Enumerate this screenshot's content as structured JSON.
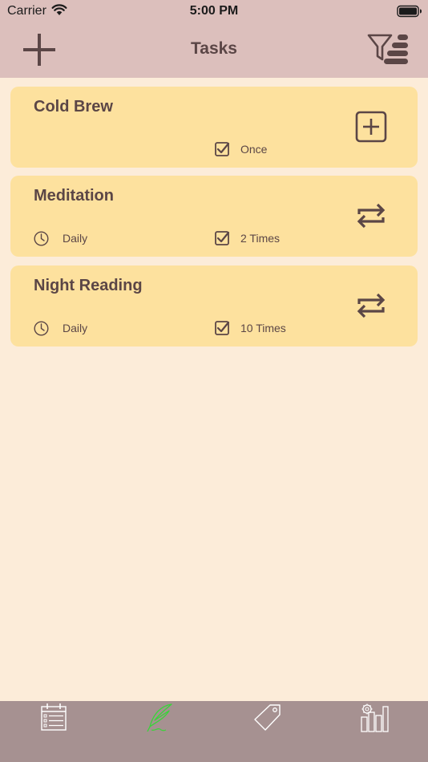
{
  "status_bar": {
    "carrier": "Carrier",
    "time": "5:00 PM"
  },
  "nav": {
    "title": "Tasks"
  },
  "tasks": [
    {
      "title": "Cold Brew",
      "frequency": "",
      "count": "Once",
      "action_icon": "add-square-icon"
    },
    {
      "title": "Meditation",
      "frequency": "Daily",
      "count": "2 Times",
      "action_icon": "repeat-icon"
    },
    {
      "title": "Night Reading",
      "frequency": "Daily",
      "count": "10 Times",
      "action_icon": "repeat-icon"
    }
  ],
  "tab_bar": {
    "items": [
      {
        "icon": "calendar-list-icon",
        "selected": false
      },
      {
        "icon": "quill-icon",
        "selected": true
      },
      {
        "icon": "tag-icon",
        "selected": false
      },
      {
        "icon": "stats-settings-icon",
        "selected": false
      }
    ]
  },
  "colors": {
    "background": "#fcecd9",
    "nav_bar": "#dcbfbc",
    "card": "#fde19e",
    "text": "#5b4646",
    "tab_bar": "#a69191",
    "tab_selected": "#39d439"
  }
}
